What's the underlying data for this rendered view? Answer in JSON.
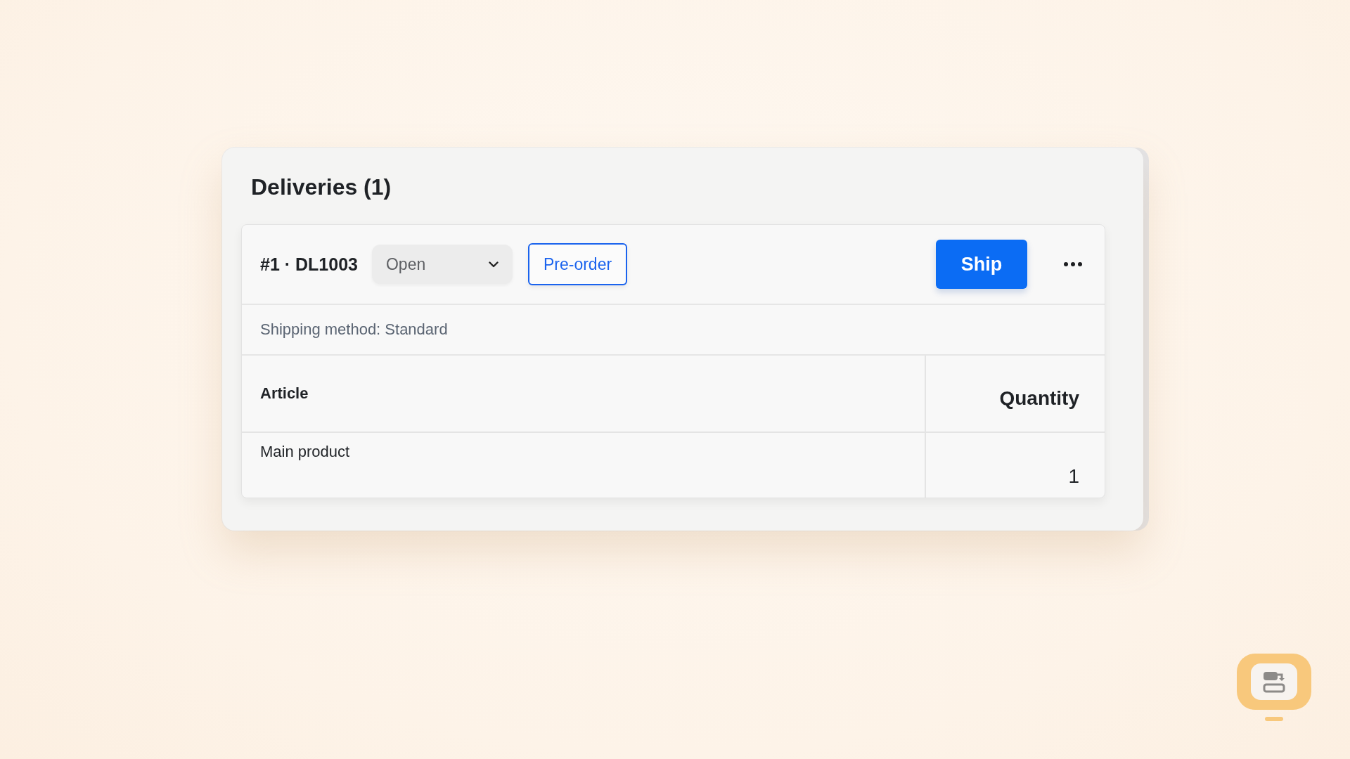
{
  "section": {
    "title": "Deliveries (1)"
  },
  "delivery": {
    "label": "#1 · DL1003",
    "status_select": {
      "value": "Open"
    },
    "tag_button": "Pre-order",
    "primary_button": "Ship",
    "shipping_method": "Shipping method: Standard",
    "table": {
      "columns": [
        "Article",
        "Quantity"
      ],
      "rows": [
        [
          "Main product",
          "1"
        ]
      ]
    }
  }
}
